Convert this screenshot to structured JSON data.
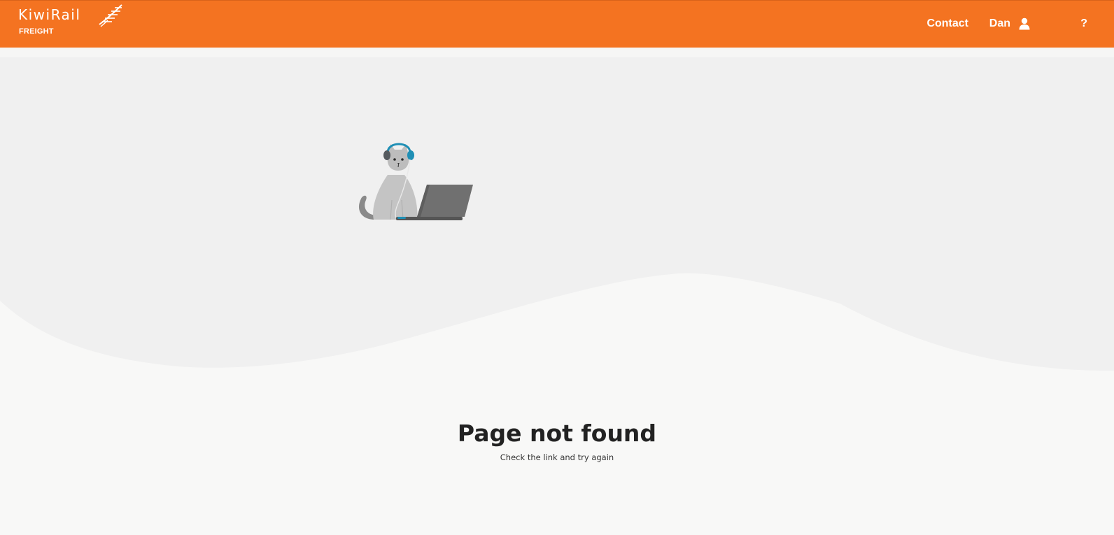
{
  "header": {
    "brand": "KiwiRail",
    "brand_sub": "FREIGHT",
    "nav": {
      "contact_label": "Contact",
      "user_label": "Dan",
      "help_label": "?"
    },
    "colors": {
      "accent": "#f47321",
      "text": "#ffffff"
    },
    "icons": {
      "logo": "kiwirail-fern-logo",
      "user": "user-icon"
    }
  },
  "main": {
    "illustration": "cat-with-headphones-and-laptop",
    "title": "Page not found",
    "message": "Check the link and try again",
    "colors": {
      "hero_bg": "#f0f0f0",
      "page_bg": "#f8f8f7",
      "title": "#222222"
    }
  }
}
